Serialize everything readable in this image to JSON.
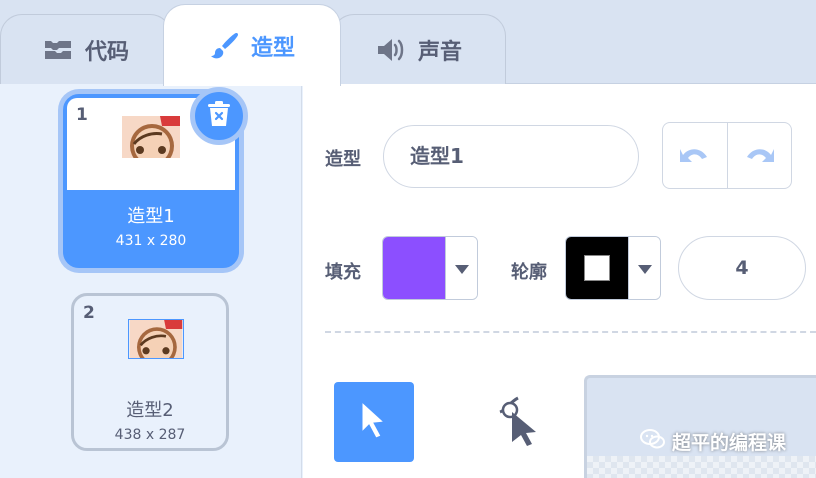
{
  "tabs": [
    {
      "label": "代码",
      "icon": "code-blocks-icon",
      "active": false
    },
    {
      "label": "造型",
      "icon": "paintbrush-icon",
      "active": true
    },
    {
      "label": "声音",
      "icon": "speaker-icon",
      "active": false
    }
  ],
  "costumes": [
    {
      "number": "1",
      "name": "造型1",
      "size": "431 x 280",
      "selected": true
    },
    {
      "number": "2",
      "name": "造型2",
      "size": "438 x 287",
      "selected": false
    }
  ],
  "editor": {
    "costume_label": "造型",
    "costume_name": "造型1",
    "fill_label": "填充",
    "fill_color": "#8c4fff",
    "outline_label": "轮廓",
    "outline_color": "#000000",
    "outline_width": "4"
  },
  "colors": {
    "accent": "#4c97ff",
    "text": "#575e75"
  },
  "watermark": "超平的编程课"
}
